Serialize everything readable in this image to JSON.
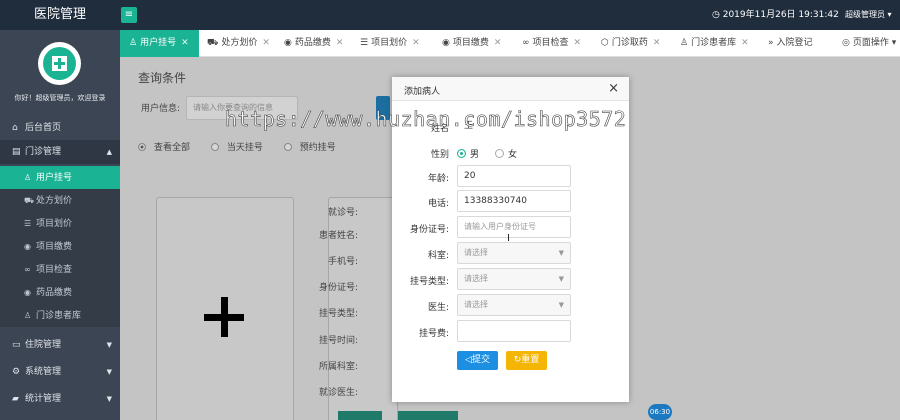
{
  "header": {
    "brand": "医院管理",
    "menu_icon": "hamburger-icon",
    "datetime": "2019年11月26日 19:31:42",
    "user": "超级管理员"
  },
  "sidebar": {
    "welcome": "你好！超级管理员，欢迎登录",
    "items": [
      {
        "label": "后台首页",
        "icon": "home-icon"
      },
      {
        "label": "门诊管理",
        "icon": "clipboard-icon",
        "expanded": true
      },
      {
        "label": "住院管理",
        "icon": "bed-icon"
      },
      {
        "label": "系统管理",
        "icon": "gear-icon"
      },
      {
        "label": "统计管理",
        "icon": "chart-icon"
      }
    ],
    "sub_items": [
      {
        "label": "用户挂号",
        "icon": "user-icon",
        "active": true
      },
      {
        "label": "处方划价",
        "icon": "cart-icon"
      },
      {
        "label": "项目划价",
        "icon": "list-icon"
      },
      {
        "label": "项目缴费",
        "icon": "coin-icon"
      },
      {
        "label": "项目检查",
        "icon": "link-icon"
      },
      {
        "label": "药品缴费",
        "icon": "coin-icon"
      },
      {
        "label": "门诊患者库",
        "icon": "user-icon"
      }
    ]
  },
  "tabs": [
    {
      "label": "用户挂号",
      "active": true
    },
    {
      "label": "处方划价"
    },
    {
      "label": "药品缴费"
    },
    {
      "label": "项目划价"
    },
    {
      "label": "项目缴费"
    },
    {
      "label": "项目检查"
    },
    {
      "label": "门诊取药"
    },
    {
      "label": "门诊患者库"
    },
    {
      "label": "入院登记"
    },
    {
      "label": "页面操作"
    }
  ],
  "main": {
    "query_title": "查询条件",
    "user_info_label": "用户信息:",
    "user_info_placeholder": "请输入你要查询的信息",
    "radio_options": [
      "查看全部",
      "当天挂号",
      "预约挂号"
    ],
    "detail_labels": [
      "就诊号:",
      "患者姓名:",
      "手机号:",
      "身份证号:",
      "挂号类型:",
      "挂号时间:",
      "所属科室:",
      "就诊医生:"
    ],
    "clock_badge": "06:30"
  },
  "modal": {
    "title": "添加病人",
    "name_label": "姓名",
    "name_value": "王",
    "gender_label": "性别",
    "gender_options": [
      "男",
      "女"
    ],
    "gender_selected": "男",
    "age_label": "年龄:",
    "age_value": "20",
    "phone_label": "电话:",
    "phone_value": "13388330740",
    "id_label": "身份证号:",
    "id_placeholder": "请输入用户身份证号",
    "dept_label": "科室:",
    "dept_placeholder": "请选择",
    "regtype_label": "挂号类型:",
    "regtype_placeholder": "请选择",
    "doctor_label": "医生:",
    "doctor_placeholder": "请选择",
    "fee_label": "挂号费:",
    "submit_label": "提交",
    "reset_label": "重置"
  },
  "watermark": "https://www.huzhan.com/ishop3572",
  "colors": {
    "brand_green": "#1ab394",
    "header_dark": "#1f2d3d",
    "sidebar": "#3c4553",
    "submit_blue": "#1c8fe3",
    "reset_yellow": "#f5b505"
  }
}
